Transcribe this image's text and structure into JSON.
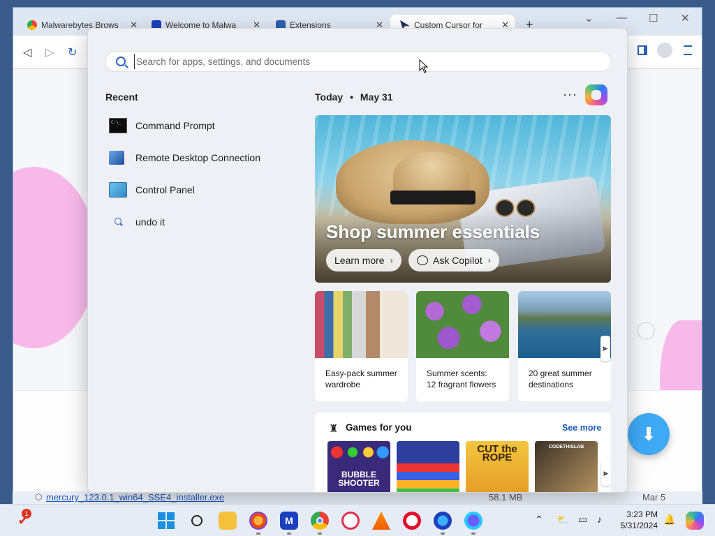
{
  "browser": {
    "tabs": [
      {
        "title": "Malwarebytes Brows",
        "close": "✕"
      },
      {
        "title": "Welcome to Malwa",
        "close": "✕"
      },
      {
        "title": "Extensions",
        "close": "✕"
      },
      {
        "title": "Custom Cursor for",
        "close": "✕"
      }
    ],
    "new_tab": "+",
    "controls": {
      "dropdown": "⌄",
      "minimize": "—",
      "maximize": "☐",
      "close": "✕"
    },
    "nav": {
      "back": "◁",
      "forward": "▷",
      "reload": "↻"
    }
  },
  "download_bar": {
    "filename": "mercury_123.0.1_win64_SSE4_installer.exe",
    "size": "58.1 MB",
    "date": "Mar 5"
  },
  "start_menu": {
    "search": {
      "placeholder": "Search for apps, settings, and documents"
    },
    "recent": {
      "heading": "Recent",
      "items": [
        {
          "label": "Command Prompt"
        },
        {
          "label": "Remote Desktop Connection"
        },
        {
          "label": "Control Panel"
        },
        {
          "label": "undo it"
        }
      ]
    },
    "today": {
      "label": "Today",
      "separator": "•",
      "date": "May 31",
      "more": "···"
    },
    "hero": {
      "title": "Shop summer essentials",
      "learn_more": "Learn more",
      "ask_copilot": "Ask Copilot",
      "chevron": "›"
    },
    "cards": [
      {
        "title": "Easy-pack summer wardrobe"
      },
      {
        "title": "Summer scents: 12 fragrant flowers"
      },
      {
        "title": "20 great summer destinations"
      }
    ],
    "games": {
      "heading": "Games for you",
      "see_more": "See more",
      "items": [
        {
          "title": "BUBBLE SHOOTER"
        },
        {
          "title": ""
        },
        {
          "title": "CUT the ROPE"
        },
        {
          "title": ""
        }
      ],
      "chess_studio": "CODETHISLAB"
    },
    "scroll_arrow": "▶"
  },
  "taskbar": {
    "badge": "1",
    "clock": {
      "time": "3:23 PM",
      "date": "5/31/2024"
    },
    "tray": {
      "chevron": "⌃"
    }
  }
}
